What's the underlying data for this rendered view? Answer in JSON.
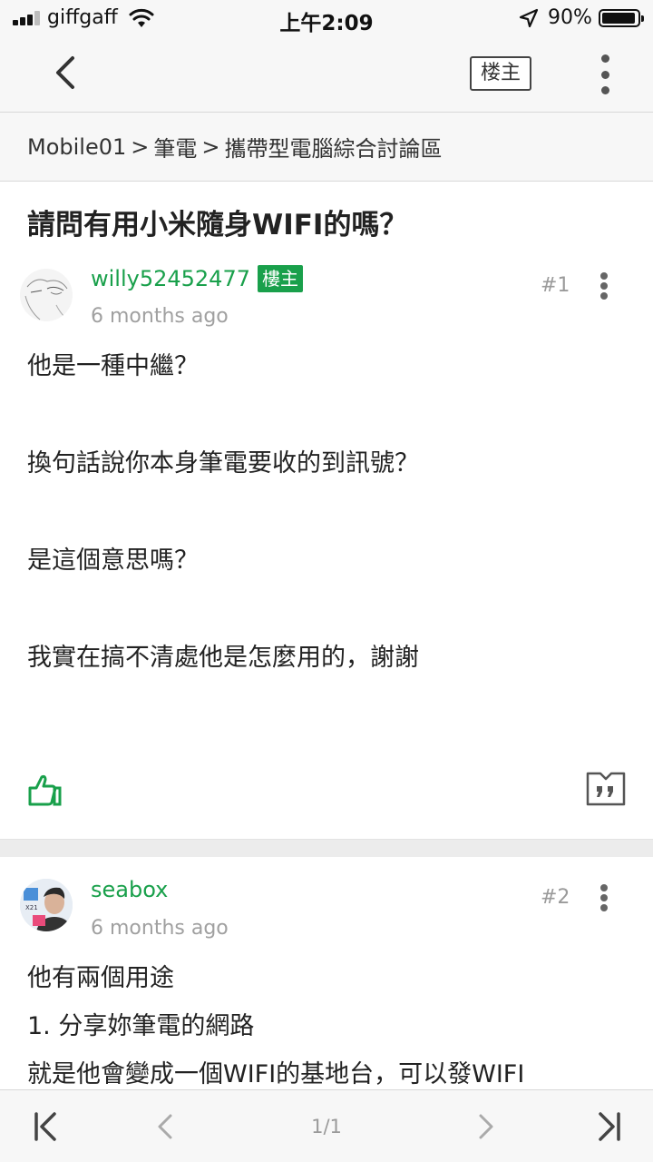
{
  "status_bar": {
    "carrier": "giffgaff",
    "time": "上午2:09",
    "battery": "90%",
    "battery_level": 0.9,
    "signal_bars": 3
  },
  "nav": {
    "back_icon": "chevron-left-icon",
    "op_filter_label": "楼主",
    "more_icon": "more-vertical-icon"
  },
  "breadcrumb": {
    "items": [
      "Mobile01",
      "筆電",
      "攜帶型電腦綜合討論區"
    ],
    "separator": ">"
  },
  "thread": {
    "title": "請問有用小米隨身WIFI的嗎？"
  },
  "posts": [
    {
      "username": "willy52452477",
      "badge": "樓主",
      "time": "6 months ago",
      "floor": "#1",
      "lines": [
        "他是一種中繼？",
        "換句話說你本身筆電要收的到訊號？",
        "是這個意思嗎？",
        "我實在搞不清處他是怎麼用的，謝謝"
      ]
    },
    {
      "username": "seabox",
      "time": "6 months ago",
      "floor": "#2",
      "lines": [
        "他有兩個用途",
        "1. 分享妳筆電的網路",
        "就是他會變成一個WIFI的基地台，可以發WIFI"
      ]
    }
  ],
  "pager": {
    "page": "1/1"
  },
  "colors": {
    "accent_green": "#19a04b",
    "bar_background": "#f7f7f7"
  }
}
